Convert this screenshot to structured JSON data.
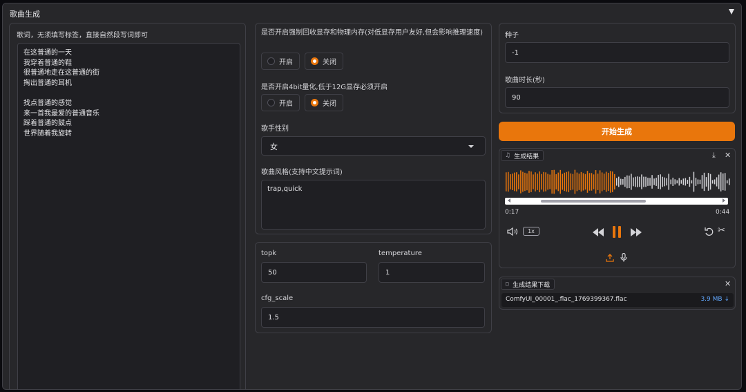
{
  "section": {
    "title": "歌曲生成"
  },
  "lyrics": {
    "label": "歌词，无须填写标签，直接自然段写词即可",
    "text": "在这普通的一天\n我穿着普通的鞋\n很普通地走在这普通的街\n掏出普通的耳机\n\n找点普通的感觉\n来一首我最爱的普通音乐\n踩着普通的鼓点\n世界随着我旋转"
  },
  "memory_release": {
    "label": "是否开启强制回收显存和物理内存(对低显存用户友好,但会影响推理速度)",
    "options": [
      "开启",
      "关闭"
    ],
    "selected": "关闭"
  },
  "quant4bit": {
    "label": "是否开启4bit量化,低于12G显存必须开启",
    "options": [
      "开启",
      "关闭"
    ],
    "selected": "关闭"
  },
  "gender": {
    "label": "歌手性别",
    "value": "女"
  },
  "style": {
    "label": "歌曲风格(支持中文提示词)",
    "value": "trap,quick"
  },
  "params": {
    "topk": {
      "label": "topk",
      "value": "50"
    },
    "temperature": {
      "label": "temperature",
      "value": "1"
    },
    "cfg_scale": {
      "label": "cfg_scale",
      "value": "1.5"
    }
  },
  "seed": {
    "label": "种子",
    "value": "-1"
  },
  "duration": {
    "label": "歌曲时长(秒)",
    "value": "90"
  },
  "generate_button": {
    "label": "开始生成"
  },
  "result": {
    "label": "生成结果",
    "current_time": "0:17",
    "total_time": "0:44",
    "speed": "1x",
    "progress": 0.49
  },
  "download": {
    "label": "生成结果下载",
    "file_name": "ComfyUI_00001_.flac_1769399367.flac",
    "file_size": "3.9 MB",
    "size_arrow": "↓"
  },
  "icons": {
    "collapse": "triangle-down-icon",
    "music": "music-note-icon",
    "file": "file-icon",
    "download": "download-icon",
    "close": "close-icon",
    "volume": "volume-icon",
    "rewind": "rewind-icon",
    "pause": "pause-icon",
    "forward": "fast-forward-icon",
    "undo": "undo-icon",
    "trim": "scissors-icon",
    "upload": "upload-icon",
    "mic": "microphone-icon"
  },
  "colors": {
    "accent": "#e9760c",
    "played_wave": "#e9760c",
    "unplayed_wave": "#d4d4d8",
    "link": "#60a5fa"
  }
}
